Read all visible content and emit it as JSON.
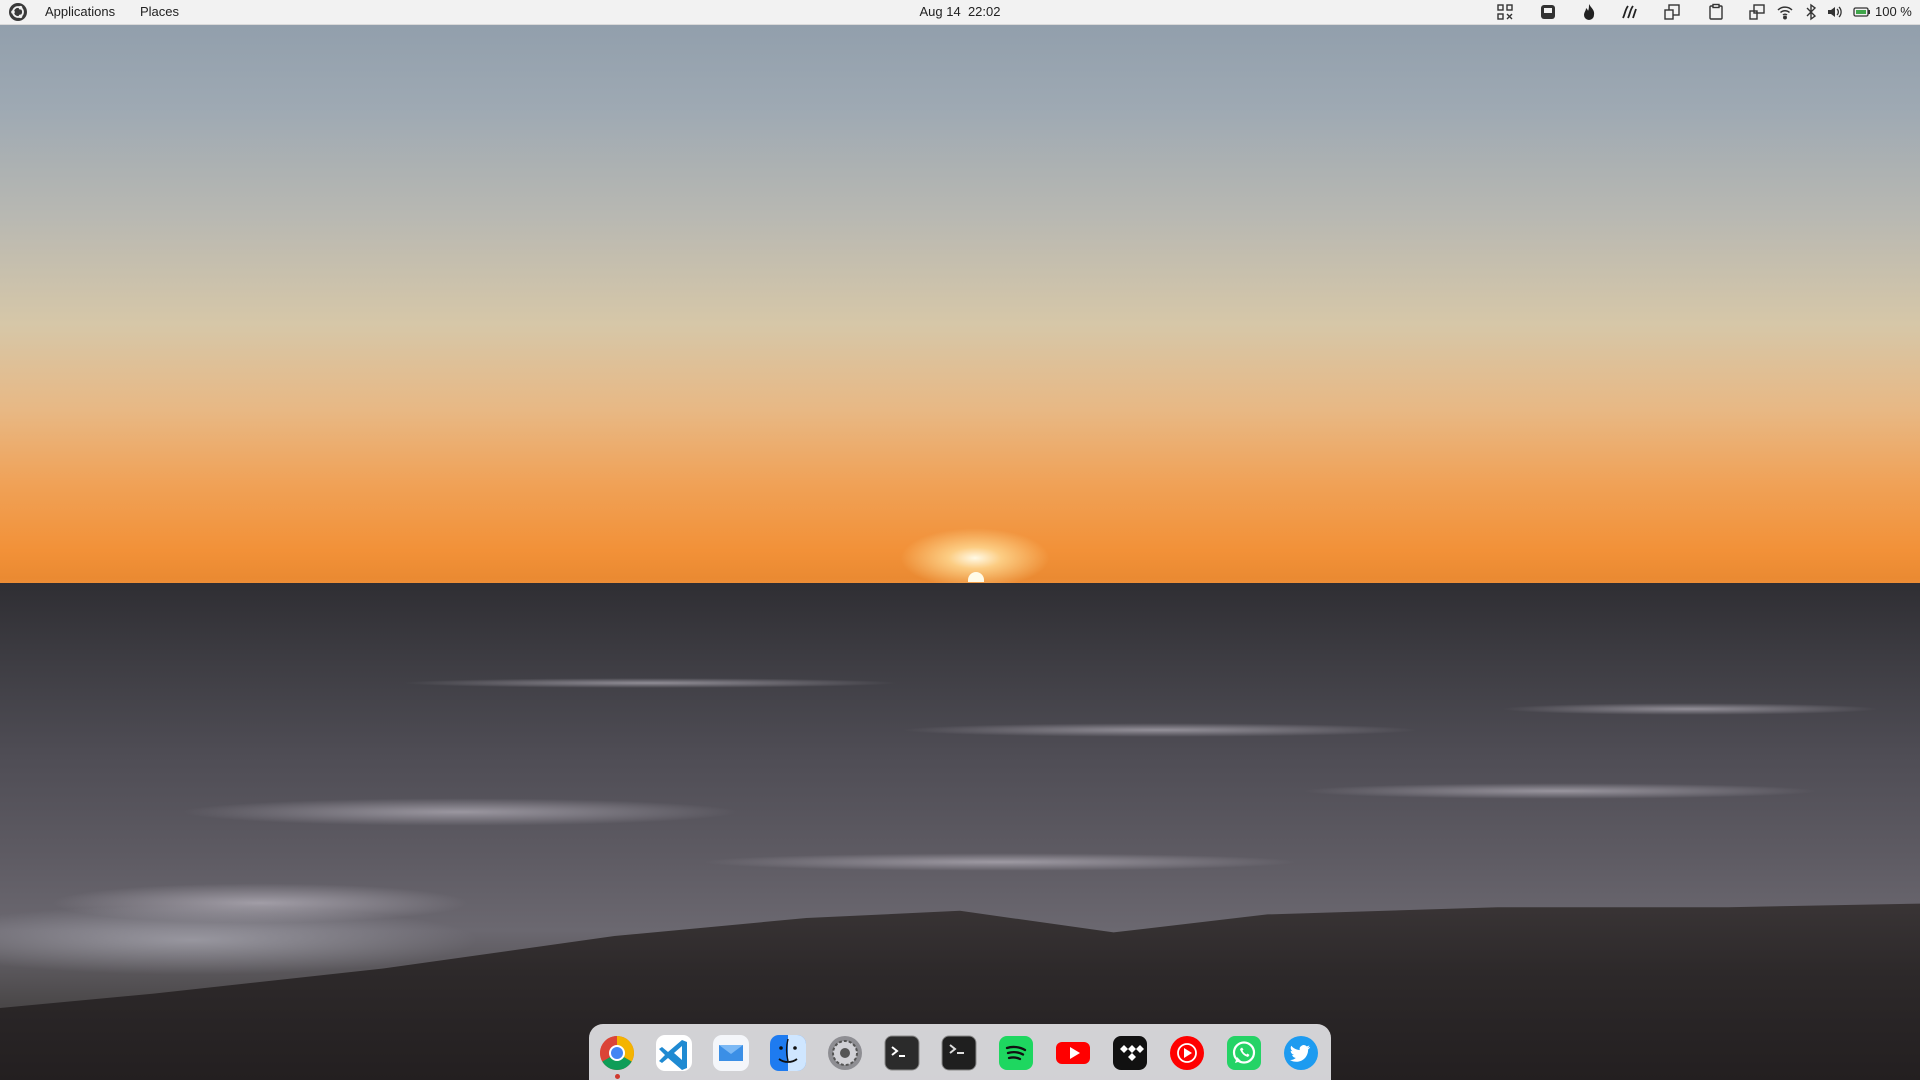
{
  "top_panel": {
    "menus": [
      {
        "label": "Applications"
      },
      {
        "label": "Places"
      }
    ],
    "clock": {
      "date": "Aug 14",
      "time": "22:02"
    },
    "battery_percent": "100 %",
    "tray_icons": [
      "grid-icon",
      "inbox-icon",
      "flame-icon",
      "steam-icon",
      "window-icon",
      "clipboard-icon",
      "screen-share-icon",
      "wifi-icon",
      "bluetooth-icon",
      "volume-icon",
      "battery-icon"
    ]
  },
  "dock": {
    "apps": [
      {
        "name": "chrome-icon",
        "color": "#4285f4"
      },
      {
        "name": "vscode-icon",
        "color": "#1f8ad2"
      },
      {
        "name": "mail-icon",
        "color": "#3b8fe6"
      },
      {
        "name": "finder-icon",
        "color": "#1e7bf0"
      },
      {
        "name": "settings-icon",
        "color": "#8e8e93"
      },
      {
        "name": "terminal-icon",
        "color": "#2b2b2b"
      },
      {
        "name": "terminal-alt-icon",
        "color": "#2b2b2b"
      },
      {
        "name": "spotify-icon",
        "color": "#1ed760"
      },
      {
        "name": "youtube-icon",
        "color": "#ff0000"
      },
      {
        "name": "tidal-icon",
        "color": "#111111"
      },
      {
        "name": "youtube-music-icon",
        "color": "#ff0000"
      },
      {
        "name": "whatsapp-icon",
        "color": "#25d366"
      },
      {
        "name": "twitter-icon",
        "color": "#1d9bf0"
      }
    ],
    "running_indicator_color": "#d03a2f"
  },
  "wallpaper": {
    "description_colors": {
      "sky_top": "#8e9caa",
      "horizon": "#f29138",
      "sea": "#3d3c42"
    }
  }
}
